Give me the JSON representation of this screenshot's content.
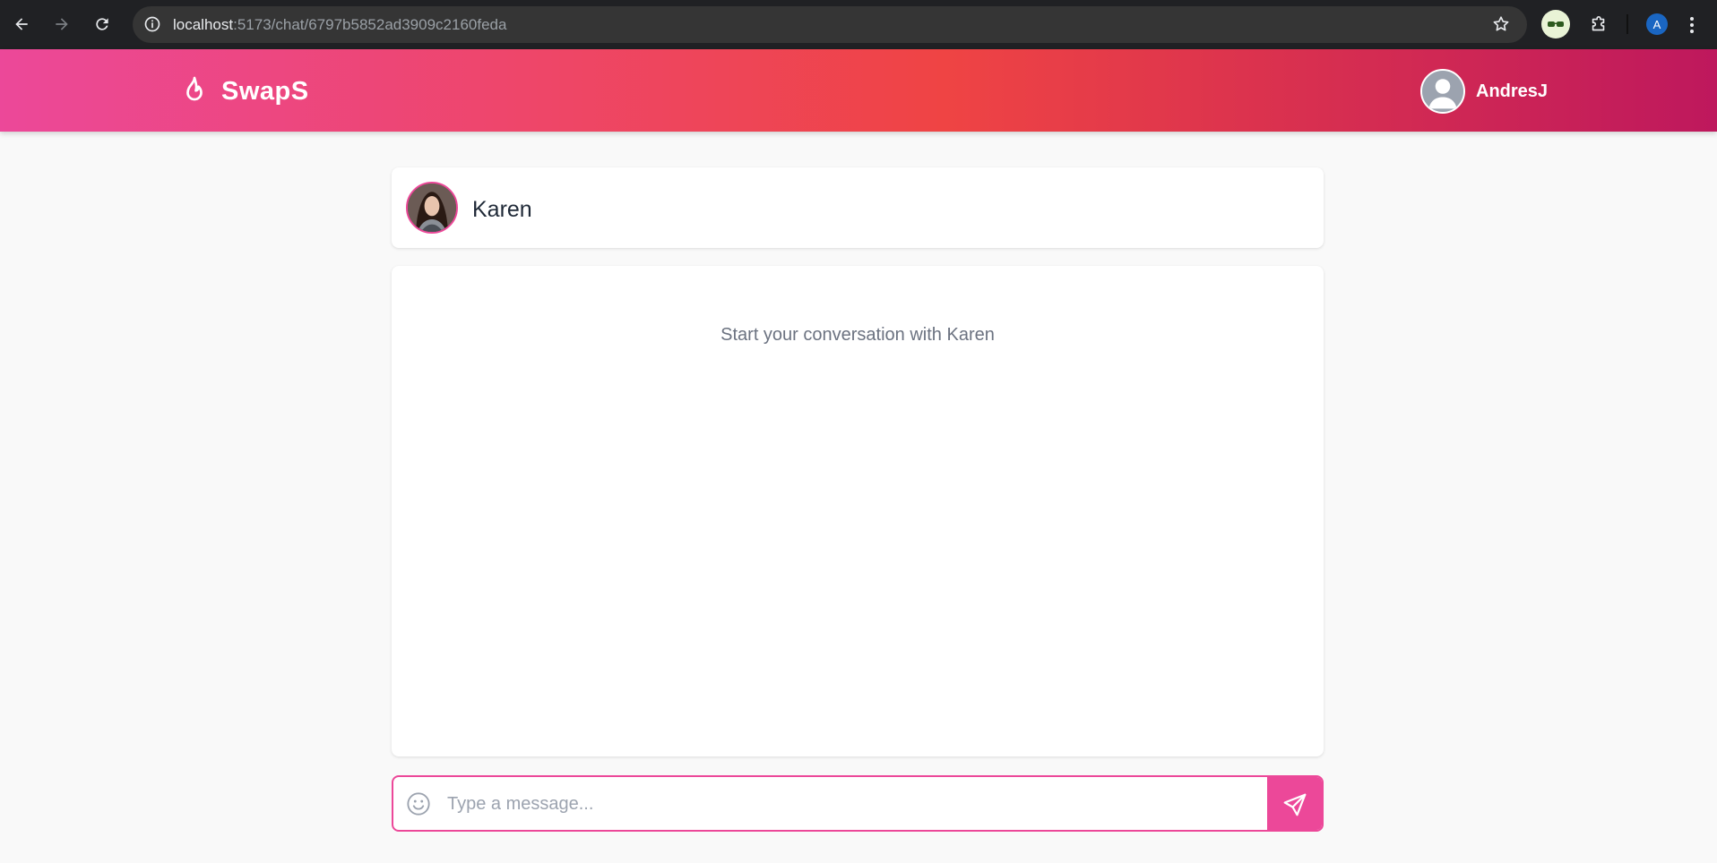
{
  "browser": {
    "url_host": "localhost",
    "url_rest": ":5173/chat/6797b5852ad3909c2160feda",
    "profile_initial": "A"
  },
  "app": {
    "brand": "SwapS",
    "current_user": "AndresJ",
    "colors": {
      "primary": "#ec4899",
      "gradient_mid": "#ef4444",
      "gradient_end": "#be185d"
    }
  },
  "chat": {
    "contact_name": "Karen",
    "empty_message": "Start your conversation with Karen",
    "input_placeholder": "Type a message..."
  }
}
